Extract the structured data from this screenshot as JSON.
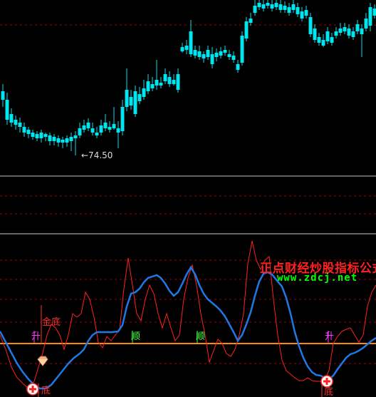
{
  "colors": {
    "bg": "#000000",
    "up": "#ff2a2a",
    "down": "#00e5ee",
    "grid_dash": "#a00000",
    "divider": "#c8c8c8",
    "zero_line": "#ff8c00",
    "blue_line": "#1e78e6",
    "red_line": "#ff2020",
    "label_purple": "#ff40ff",
    "label_green": "#40ff40",
    "label_red": "#ff3030",
    "annotation": "#dcdcdc"
  },
  "price_panel": {
    "low_annotation": "←74.50"
  },
  "watermark": {
    "title": "正点财经炒股指标公式",
    "url": "www.zdcj.net"
  },
  "indicator_labels": {
    "jin_di": "金底",
    "sheng_1": "升",
    "shun_1": "顺",
    "shun_2": "顺",
    "sheng_2": "升",
    "di_1": "底",
    "di_2": "底"
  },
  "icons": [
    "diamond-icon",
    "cross-circle-icon"
  ]
}
